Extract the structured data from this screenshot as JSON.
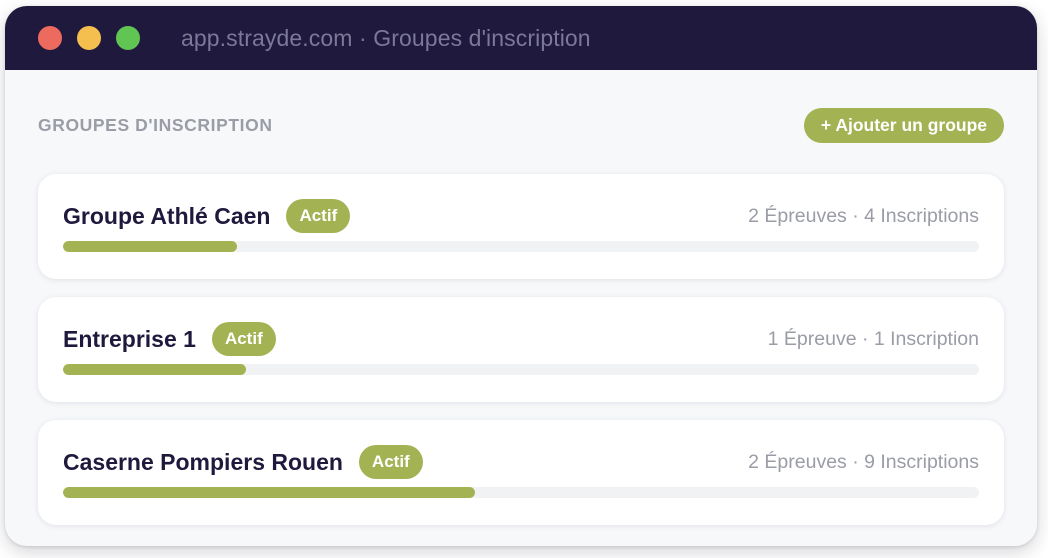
{
  "window": {
    "url": "app.strayde.com · Groupes d'inscription"
  },
  "section": {
    "title": "GROUPES D'INSCRIPTION",
    "add_label": "+ Ajouter un groupe"
  },
  "groups": [
    {
      "name": "Groupe Athlé Caen",
      "status": "Actif",
      "meta": "2 Épreuves · 4 Inscriptions",
      "progress": 0.19
    },
    {
      "name": "Entreprise 1",
      "status": "Actif",
      "meta": "1 Épreuve · 1 Inscription",
      "progress": 0.2
    },
    {
      "name": "Caserne Pompiers Rouen",
      "status": "Actif",
      "meta": "2 Épreuves · 9 Inscriptions",
      "progress": 0.45
    }
  ],
  "colors": {
    "titlebar": "#1f1a3d",
    "accent": "#a3b354",
    "close": "#ed6a5e",
    "minimize": "#f5bf4f",
    "maximize": "#61c554"
  }
}
